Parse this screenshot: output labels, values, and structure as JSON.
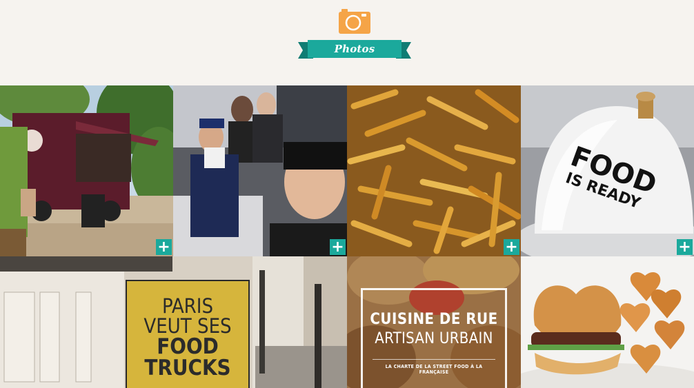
{
  "section": {
    "icon": "camera-icon",
    "title": "Photos",
    "accent": "#1ba99c",
    "icon_color": "#f5a447"
  },
  "gallery": {
    "expand_icon": "plus-icon",
    "expand_symbol": "+",
    "tiles": [
      {
        "id": "food-truck-photo",
        "caption_lines": []
      },
      {
        "id": "crew-selfie-photo",
        "caption_lines": []
      },
      {
        "id": "fries-photo",
        "caption_lines": []
      },
      {
        "id": "service-bell-photo",
        "caption_lines": [
          "FOOD",
          "IS READY"
        ]
      },
      {
        "id": "paris-street-sign-photo",
        "caption_lines": [
          "PARIS",
          "VEUT SES",
          "FOOD",
          "TRUCKS"
        ]
      },
      {
        "id": "cuisine-de-rue-photo",
        "caption_lines": [
          "CUISINE DE RUE",
          "ARTISAN URBAIN",
          "LA CHARTE DE LA STREET FOOD À LA FRANÇAISE"
        ]
      },
      {
        "id": "heart-burger-photo",
        "caption_lines": []
      }
    ]
  }
}
